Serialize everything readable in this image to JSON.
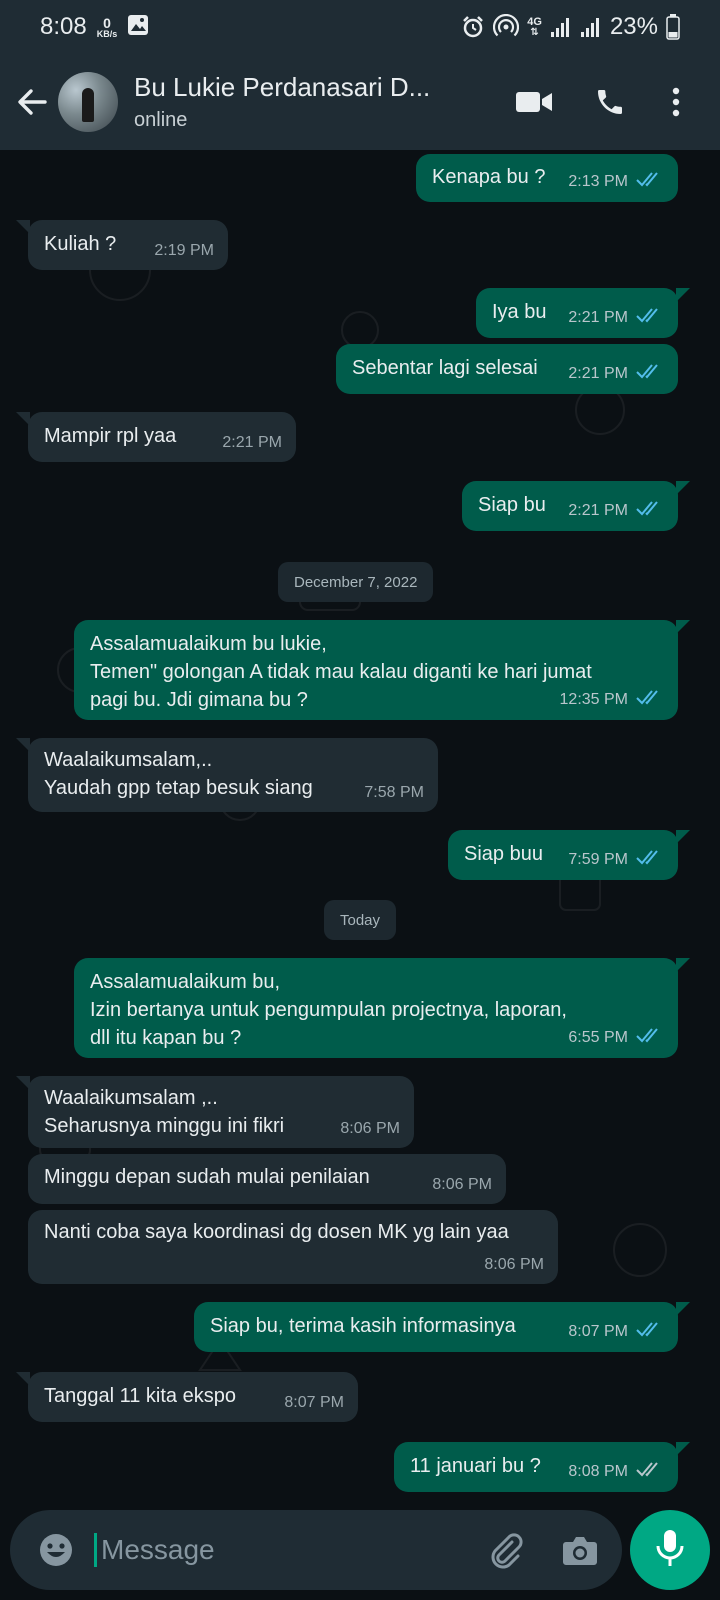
{
  "status_bar": {
    "time": "8:08",
    "net_speed_value": "0",
    "net_speed_unit": "KB/s",
    "network_label": "4G",
    "battery_percent": "23%"
  },
  "header": {
    "contact_name": "Bu Lukie Perdanasari D...",
    "status": "online"
  },
  "messages": [
    {
      "direction": "out",
      "text": "Kenapa bu ?",
      "time": "2:13 PM",
      "ticks": "read"
    },
    {
      "direction": "in",
      "text": "Kuliah ?",
      "time": "2:19 PM"
    },
    {
      "direction": "out",
      "text": "Iya bu",
      "time": "2:21 PM",
      "ticks": "read"
    },
    {
      "direction": "out",
      "text": "Sebentar lagi selesai",
      "time": "2:21 PM",
      "ticks": "read"
    },
    {
      "direction": "in",
      "text": "Mampir rpl yaa",
      "time": "2:21 PM"
    },
    {
      "direction": "out",
      "text": "Siap bu",
      "time": "2:21 PM",
      "ticks": "read"
    },
    {
      "type": "date",
      "text": "December 7, 2022"
    },
    {
      "direction": "out",
      "text": "Assalamualaikum bu lukie,\nTemen\" golongan A tidak mau kalau diganti ke hari jumat\npagi bu. Jdi gimana bu ?",
      "time": "12:35 PM",
      "ticks": "read"
    },
    {
      "direction": "in",
      "text": "Waalaikumsalam,..\nYaudah gpp tetap besuk siang",
      "time": "7:58 PM"
    },
    {
      "direction": "out",
      "text": "Siap buu",
      "time": "7:59 PM",
      "ticks": "read"
    },
    {
      "type": "date",
      "text": "Today"
    },
    {
      "direction": "out",
      "text": "Assalamualaikum bu,\nIzin bertanya untuk pengumpulan projectnya, laporan,\ndll itu kapan bu ?",
      "time": "6:55 PM",
      "ticks": "read"
    },
    {
      "direction": "in",
      "text": "Waalaikumsalam ,..\nSeharusnya minggu ini fikri",
      "time": "8:06 PM"
    },
    {
      "direction": "in",
      "text": "Minggu depan sudah mulai penilaian",
      "time": "8:06 PM"
    },
    {
      "direction": "in",
      "text": "Nanti coba saya koordinasi dg dosen MK yg lain yaa",
      "time": "8:06 PM"
    },
    {
      "direction": "out",
      "text": "Siap bu, terima kasih informasinya",
      "time": "8:07 PM",
      "ticks": "read"
    },
    {
      "direction": "in",
      "text": "Tanggal 11 kita ekspo",
      "time": "8:07 PM"
    },
    {
      "direction": "out",
      "text": "11 januari bu ?",
      "time": "8:08 PM",
      "ticks": "delivered"
    }
  ],
  "input": {
    "placeholder": "Message"
  },
  "colors": {
    "header_bg": "#1f2c34",
    "chat_bg": "#0b1014",
    "outgoing_bubble": "#005c4b",
    "incoming_bubble": "#202c33",
    "accent": "#00a884",
    "read_tick": "#53bdeb"
  },
  "icons": {
    "back": "arrow-left-icon",
    "video": "video-call-icon",
    "call": "phone-icon",
    "menu": "more-vertical-icon",
    "emoji": "emoji-icon",
    "attach": "paperclip-icon",
    "camera": "camera-icon",
    "mic": "microphone-icon"
  }
}
